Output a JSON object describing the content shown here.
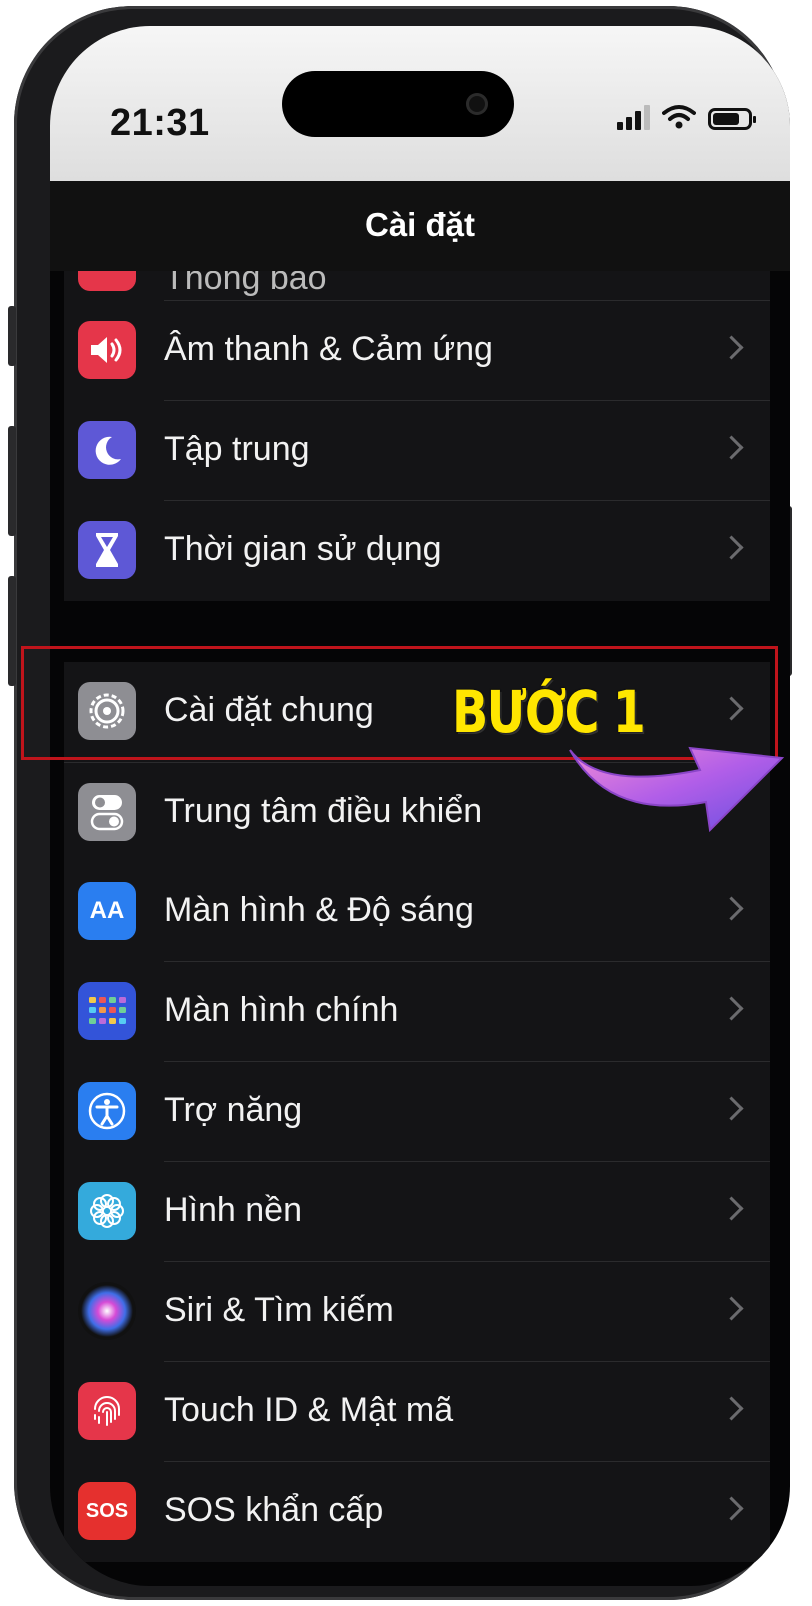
{
  "status_bar": {
    "time": "21:31"
  },
  "nav": {
    "title": "Cài đặt"
  },
  "partial_item": {
    "label": "Thông báo"
  },
  "group1": [
    {
      "label": "Âm thanh & Cảm ứng",
      "icon": "speaker-icon",
      "color": "#e5364a"
    },
    {
      "label": "Tập trung",
      "icon": "moon-icon",
      "color": "#5e58d6"
    },
    {
      "label": "Thời gian sử dụng",
      "icon": "hourglass-icon",
      "color": "#5e58d6"
    }
  ],
  "general": {
    "label": "Cài đặt chung",
    "icon": "gear-icon",
    "color": "#8e8e93"
  },
  "group2": [
    {
      "label": "Trung tâm điều khiển",
      "icon": "toggles-icon",
      "color": "#8e8e93"
    },
    {
      "label": "Màn hình & Độ sáng",
      "icon": "text-size-icon",
      "color": "#2a7ef0"
    },
    {
      "label": "Màn hình chính",
      "icon": "home-grid-icon",
      "color": "#3354d9"
    },
    {
      "label": "Trợ năng",
      "icon": "accessibility-icon",
      "color": "#2a7ef0"
    },
    {
      "label": "Hình nền",
      "icon": "flower-icon",
      "color": "#34aadc"
    },
    {
      "label": "Siri & Tìm kiếm",
      "icon": "siri-icon",
      "color": "#222"
    },
    {
      "label": "Touch ID & Mật mã",
      "icon": "fingerprint-icon",
      "color": "#e5364a"
    },
    {
      "label": "SOS khẩn cấp",
      "icon": "sos-icon",
      "color": "#e5302e"
    }
  ],
  "overlay": {
    "step_label": "BƯỚC 1"
  },
  "icon_text": {
    "text_size": "AA",
    "sos": "SOS"
  }
}
